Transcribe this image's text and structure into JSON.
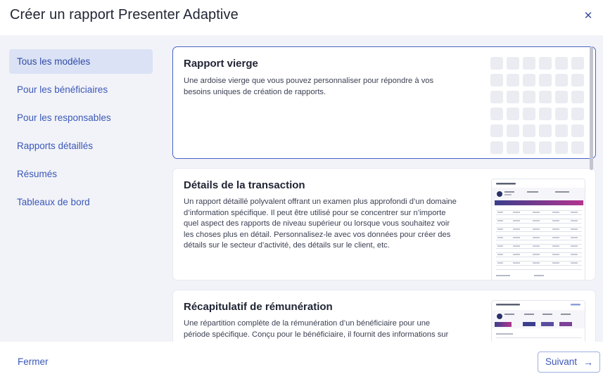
{
  "dialog": {
    "title": "Créer un rapport Presenter Adaptive",
    "close_icon": "close-icon"
  },
  "sidebar": {
    "items": [
      {
        "label": "Tous les modèles",
        "active": true
      },
      {
        "label": "Pour les bénéficiaires",
        "active": false
      },
      {
        "label": "Pour les responsables",
        "active": false
      },
      {
        "label": "Rapports détaillés",
        "active": false
      },
      {
        "label": "Résumés",
        "active": false
      },
      {
        "label": "Tableaux de bord",
        "active": false
      }
    ]
  },
  "templates": [
    {
      "title": "Rapport vierge",
      "description": "Une ardoise vierge que vous pouvez personnaliser pour répondre à vos besoins uniques de création de rapports.",
      "selected": true,
      "thumbnail": "blank-grid"
    },
    {
      "title": "Détails de la transaction",
      "description": "Un rapport détaillé polyvalent offrant un examen plus approfondi d’un domaine d’information spécifique. Il peut être utilisé pour se concentrer sur n’importe quel aspect des rapports de niveau supérieur ou lorsque vous souhaitez voir les choses plus en détail. Personnalisez-le avec vos données pour créer des détails sur le secteur d’activité, des détails sur le client, etc.",
      "selected": false,
      "thumbnail": "table-report"
    },
    {
      "title": "Récapitulatif de rémunération",
      "description": "Une répartition complète de la rémunération d’un bénéficiaire pour une période spécifique. Conçu pour le bénéficiaire, il fournit des informations sur les",
      "selected": false,
      "thumbnail": "summary-report"
    }
  ],
  "footer": {
    "close_label": "Fermer",
    "next_label": "Suivant",
    "next_icon": "arrow-right-icon"
  },
  "colors": {
    "accent": "#3a57b8",
    "selected_border": "#4863c4",
    "body_bg": "#f2f3f8"
  }
}
